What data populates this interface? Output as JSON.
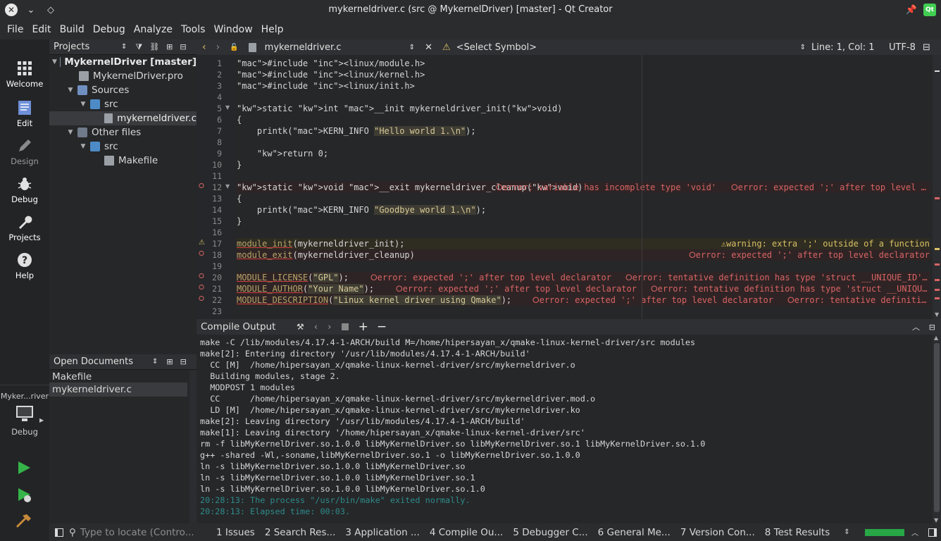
{
  "window": {
    "title": "mykerneldriver.c (src @ MykernelDriver) [master] - Qt Creator"
  },
  "menu": [
    "File",
    "Edit",
    "Build",
    "Debug",
    "Analyze",
    "Tools",
    "Window",
    "Help"
  ],
  "modes": [
    {
      "label": "Welcome",
      "icon": "grid-icon"
    },
    {
      "label": "Edit",
      "icon": "document-icon"
    },
    {
      "label": "Design",
      "icon": "pencil-icon"
    },
    {
      "label": "Debug",
      "icon": "bug-icon"
    },
    {
      "label": "Projects",
      "icon": "wrench-icon"
    },
    {
      "label": "Help",
      "icon": "help-icon"
    }
  ],
  "kit": {
    "name": "Myker...river",
    "label": "Debug"
  },
  "projects": {
    "header": "Projects",
    "tree": [
      {
        "label": "MykernelDriver [master]",
        "depth": 0,
        "type": "project",
        "bold": true
      },
      {
        "label": "MykernelDriver.pro",
        "depth": 1,
        "type": "file"
      },
      {
        "label": "Sources",
        "depth": 1,
        "type": "folder"
      },
      {
        "label": "src",
        "depth": 2,
        "type": "folder"
      },
      {
        "label": "mykerneldriver.c",
        "depth": 3,
        "type": "file",
        "selected": true
      },
      {
        "label": "Other files",
        "depth": 1,
        "type": "folder"
      },
      {
        "label": "src",
        "depth": 2,
        "type": "folder"
      },
      {
        "label": "Makefile",
        "depth": 3,
        "type": "file"
      }
    ]
  },
  "open_documents": {
    "header": "Open Documents",
    "items": [
      "Makefile",
      "mykerneldriver.c"
    ]
  },
  "editor": {
    "filename": "mykerneldriver.c",
    "symbol": "<Select Symbol>",
    "position": "Line: 1, Col: 1",
    "encoding": "UTF-8",
    "lines": [
      "#include <linux/module.h>",
      "#include <linux/kernel.h>",
      "#include <linux/init.h>",
      "",
      "static int __init mykerneldriver_init(void)",
      "{",
      "    printk(KERN_INFO \"Hello world 1.\\n\");",
      "",
      "    return 0;",
      "}",
      "",
      "static void __exit mykerneldriver_cleanup(void)",
      "{",
      "    printk(KERN_INFO \"Goodbye world 1.\\n\");",
      "}",
      "",
      "module_init(mykerneldriver_init);",
      "module_exit(mykerneldriver_cleanup)",
      "",
      "MODULE_LICENSE(\"GPL\");",
      "MODULE_AUTHOR(\"Your Name\");",
      "MODULE_DESCRIPTION(\"Linux kernel driver using Qmake\");",
      ""
    ],
    "annotations": {
      "l12a": "error: variable has incomplete type 'void'",
      "l12b": "error: expected ';' after top level …",
      "l17": "warning: extra ';' outside of a function",
      "l18": "error: expected ';' after top level declarator",
      "l20a": "error: expected ';' after top level declarator",
      "l20b": "error: tentative definition has type 'struct __UNIQUE_ID'…",
      "l21a": "error: expected ';' after top level declarator",
      "l21b": "error: tentative definition has type 'struct __UNIQU…",
      "l22a": "error: expected ';' after top level declarator",
      "l22b": "error: tentative definiti…"
    }
  },
  "compile": {
    "header": "Compile Output",
    "lines": [
      "make -C /lib/modules/4.17.4-1-ARCH/build M=/home/hipersayan_x/qmake-linux-kernel-driver/src modules",
      "make[2]: Entering directory '/usr/lib/modules/4.17.4-1-ARCH/build'",
      "  CC [M]  /home/hipersayan_x/qmake-linux-kernel-driver/src/mykerneldriver.o",
      "  Building modules, stage 2.",
      "  MODPOST 1 modules",
      "  CC      /home/hipersayan_x/qmake-linux-kernel-driver/src/mykerneldriver.mod.o",
      "  LD [M]  /home/hipersayan_x/qmake-linux-kernel-driver/src/mykerneldriver.ko",
      "make[2]: Leaving directory '/usr/lib/modules/4.17.4-1-ARCH/build'",
      "make[1]: Leaving directory '/home/hipersayan_x/qmake-linux-kernel-driver/src'",
      "rm -f libMyKernelDriver.so.1.0.0 libMyKernelDriver.so libMyKernelDriver.so.1 libMyKernelDriver.so.1.0",
      "g++ -shared -Wl,-soname,libMyKernelDriver.so.1 -o libMyKernelDriver.so.1.0.0",
      "ln -s libMyKernelDriver.so.1.0.0 libMyKernelDriver.so",
      "ln -s libMyKernelDriver.so.1.0.0 libMyKernelDriver.so.1",
      "ln -s libMyKernelDriver.so.1.0.0 libMyKernelDriver.so.1.0",
      "20:28:13: The process \"/usr/bin/make\" exited normally.",
      "20:28:13: Elapsed time: 00:03."
    ]
  },
  "status": {
    "locate_placeholder": "Type to locate (Contro...",
    "panes": [
      "1  Issues",
      "2  Search Res...",
      "3  Application ...",
      "4  Compile Ou...",
      "5  Debugger C...",
      "6  General Me...",
      "7  Version Con...",
      "8  Test Results"
    ],
    "build_progress": 1.0
  },
  "colors": {
    "accent": "#4d8bc7",
    "error": "#d86464",
    "warning": "#d8c064",
    "progress": "#27a745"
  }
}
